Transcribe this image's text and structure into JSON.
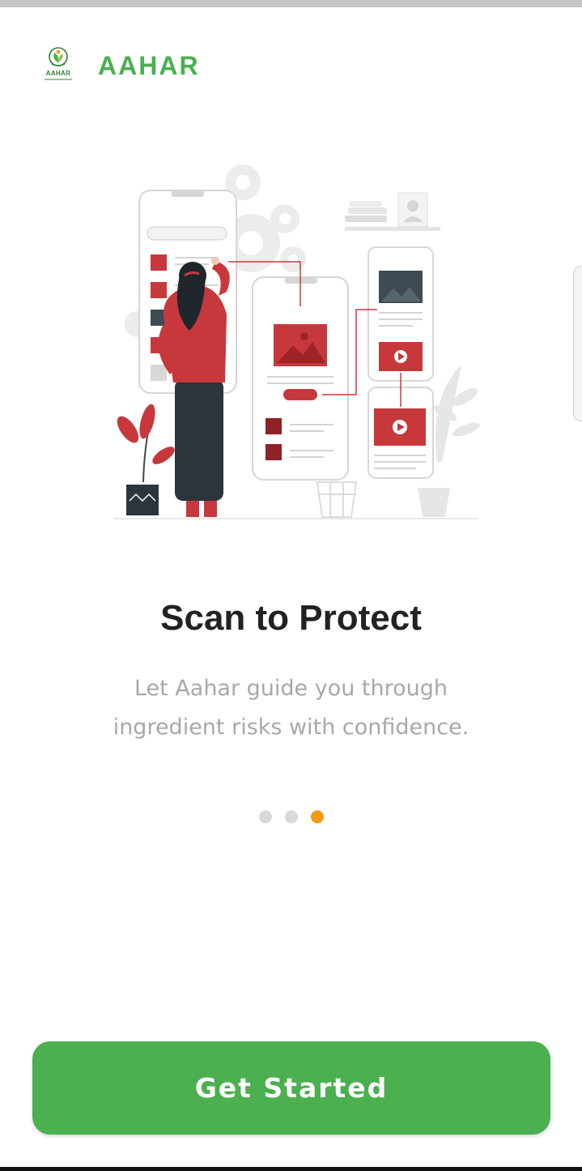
{
  "header": {
    "logo_text": "AAHAR",
    "brand_name": "AAHAR"
  },
  "onboarding": {
    "title": "Scan to Protect",
    "subtitle": "Let Aahar guide you through ingredient risks with confidence.",
    "page_indicator": {
      "total": 3,
      "current": 3
    }
  },
  "actions": {
    "get_started_label": "Get Started"
  },
  "colors": {
    "brand_green": "#4caf50",
    "accent_orange": "#f29a11",
    "illustration_red": "#c7383d",
    "title": "#222222",
    "subtitle": "#a8a8a8"
  },
  "icons": [
    "logo-emblem-icon",
    "onboarding-illustration"
  ]
}
